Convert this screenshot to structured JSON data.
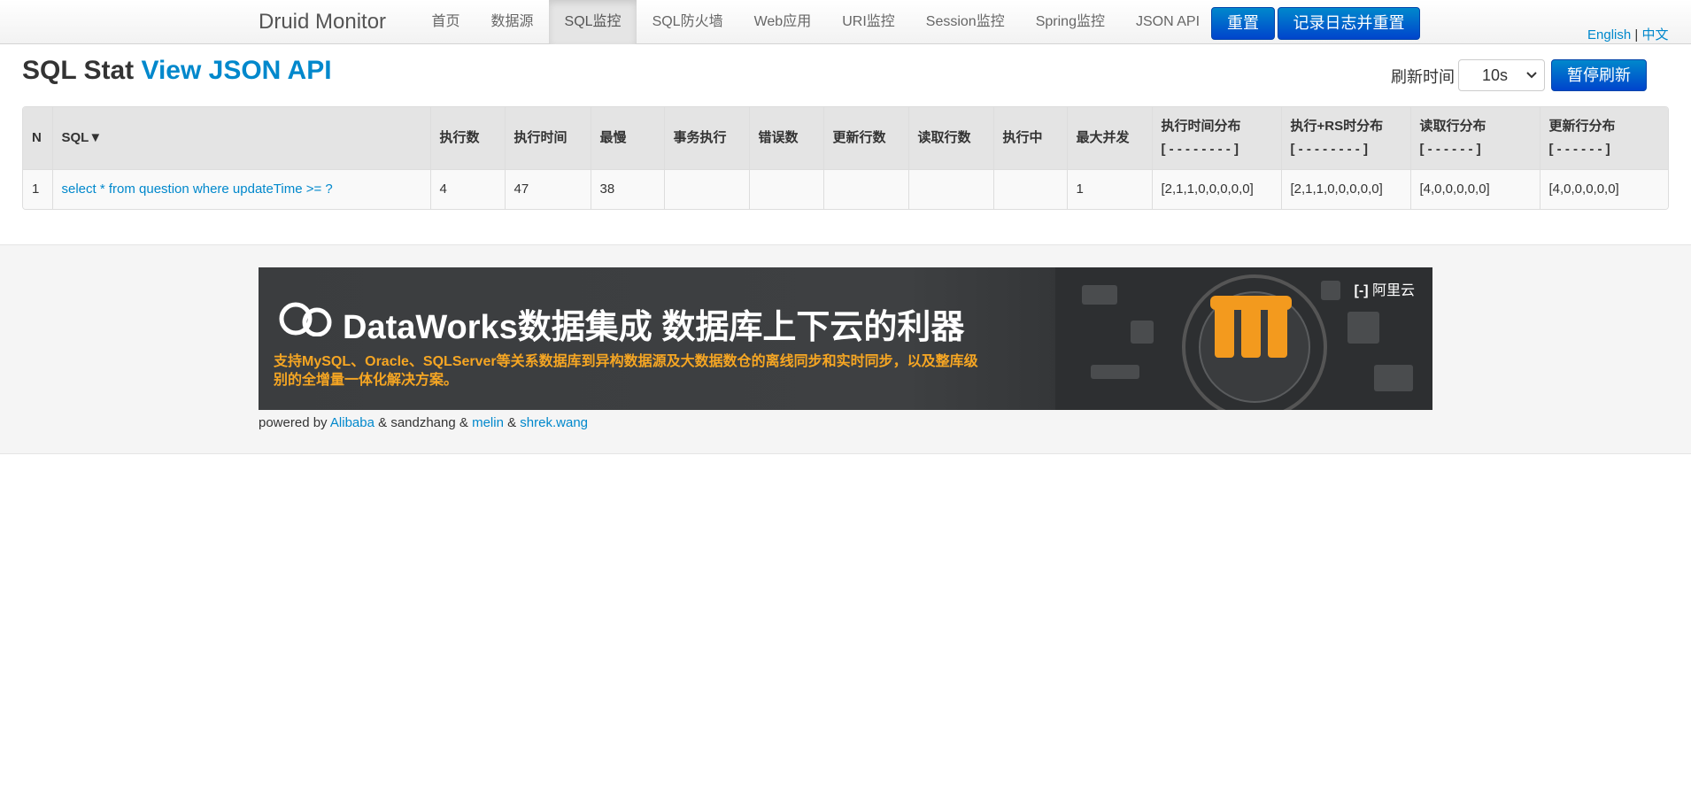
{
  "navbar": {
    "brand": "Druid Monitor",
    "items": [
      "首页",
      "数据源",
      "SQL监控",
      "SQL防火墙",
      "Web应用",
      "URI监控",
      "Session监控",
      "Spring监控",
      "JSON API"
    ],
    "reset_label": "重置",
    "log_reset_label": "记录日志并重置",
    "lang_en": "English",
    "lang_sep": "|",
    "lang_zh": "中文"
  },
  "header": {
    "title": "SQL Stat",
    "json_link": "View JSON API",
    "refresh_label": "刷新时间",
    "refresh_value": "10s",
    "pause_label": "暂停刷新"
  },
  "table": {
    "headers": {
      "n": "N",
      "sql": "SQL▼",
      "exec_count": "执行数",
      "exec_time": "执行时间",
      "slowest": "最慢",
      "txn": "事务执行",
      "errors": "错误数",
      "update_rows": "更新行数",
      "read_rows": "读取行数",
      "running": "执行中",
      "max_concurrent": "最大并发",
      "exec_hist": "执行时间分布",
      "exec_hist_sub": "[ - - - - - - - - ]",
      "exec_rs_hist": "执行+RS时分布",
      "exec_rs_hist_sub": "[ - - - - - - - - ]",
      "read_hist": "读取行分布",
      "read_hist_sub": "[ - - - - - - ]",
      "update_hist": "更新行分布",
      "update_hist_sub": "[ - - - - - - ]"
    },
    "rows": [
      {
        "n": "1",
        "sql": "select * from question where updateTime >= ?",
        "exec_count": "4",
        "exec_time": "47",
        "slowest": "38",
        "txn": "",
        "errors": "",
        "update_rows": "",
        "read_rows": "",
        "running": "",
        "max_concurrent": "1",
        "exec_hist": "[2,1,1,0,0,0,0,0]",
        "exec_rs_hist": "[2,1,1,0,0,0,0,0]",
        "read_hist": "[4,0,0,0,0,0]",
        "update_hist": "[4,0,0,0,0,0]"
      }
    ]
  },
  "footer": {
    "banner_title": "DataWorks数据集成 数据库上下云的利器",
    "banner_sub": "支持MySQL、Oracle、SQLServer等关系数据库到异构数据源及大数据数仓的离线同步和实时同步，以及整库级别的全增量一体化解决方案。",
    "banner_brand": "阿里云",
    "powered_prefix": "powered by",
    "alibaba": "Alibaba",
    "amp1": "&",
    "sandzhang": "sandzhang",
    "amp2": "&",
    "melin": "melin",
    "amp3": "&",
    "shrek": "shrek.wang"
  },
  "colors": {
    "accent": "#0088cc",
    "button": "#0055cc",
    "banner_text": "#f6a623"
  }
}
